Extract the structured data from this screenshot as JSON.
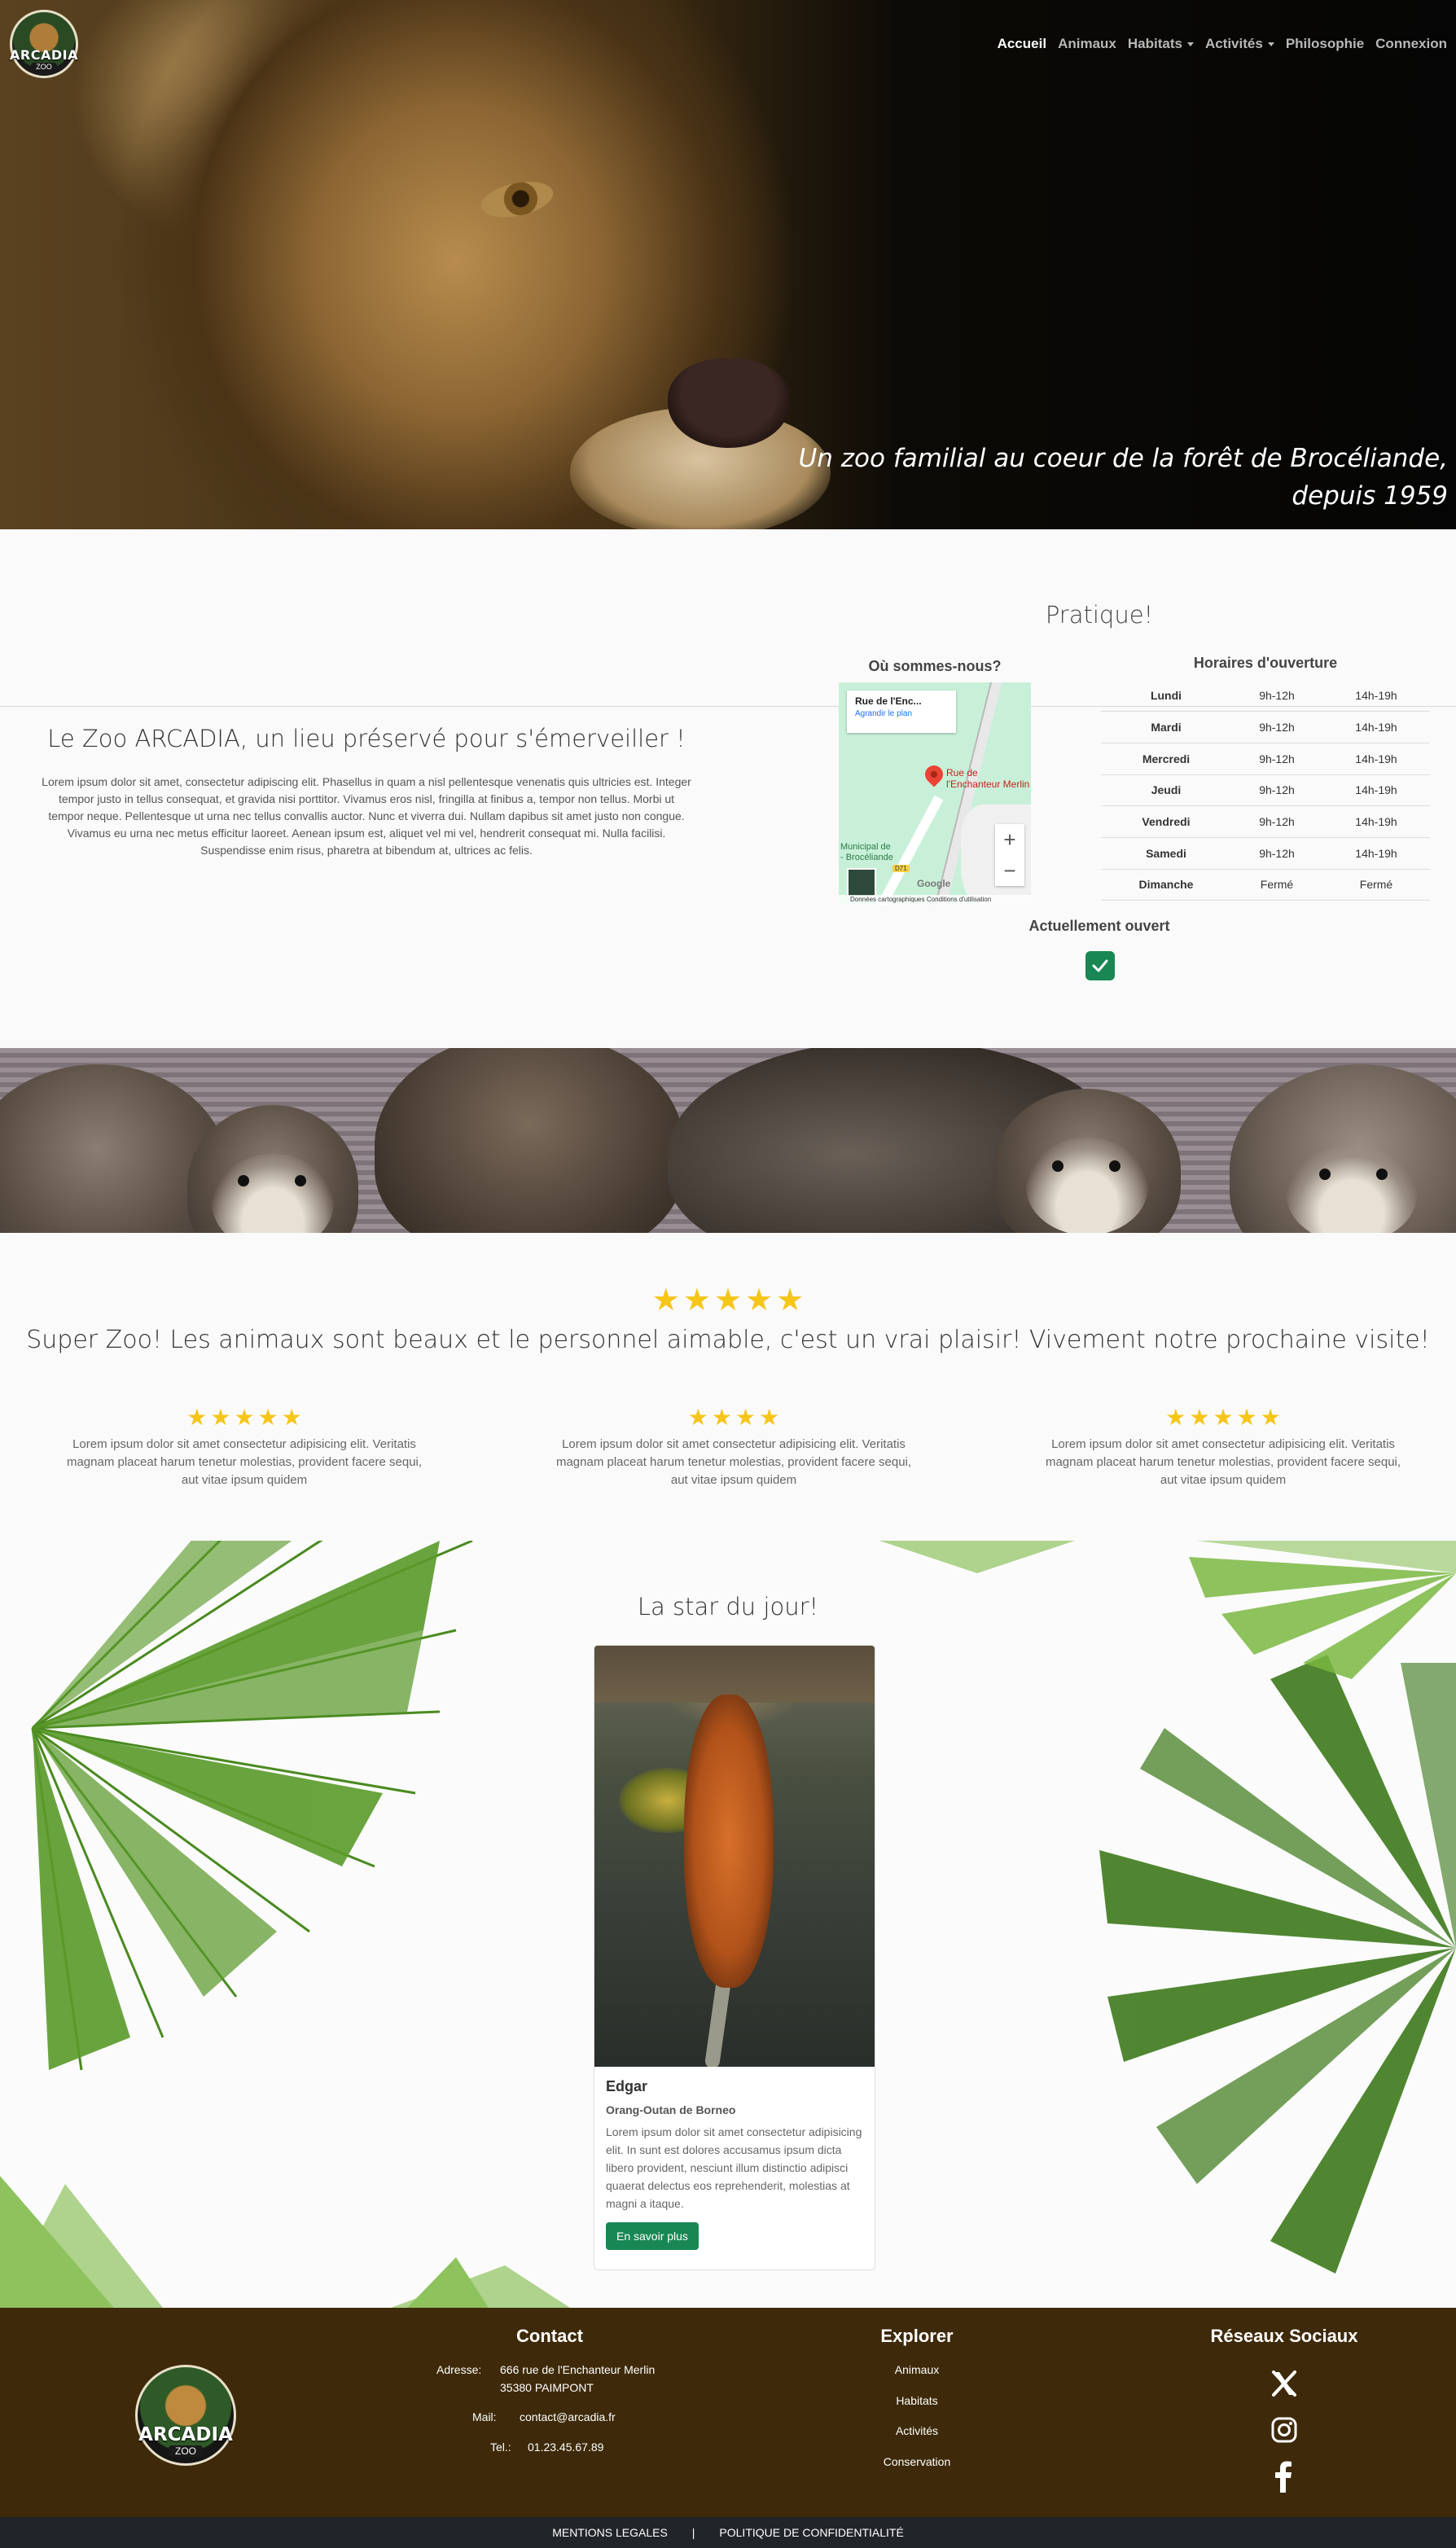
{
  "brand": {
    "logo_text": "ARCADIA",
    "logo_sub": "ZOO"
  },
  "nav": {
    "items": [
      {
        "label": "Accueil",
        "active": true,
        "dropdown": false
      },
      {
        "label": "Animaux",
        "active": false,
        "dropdown": false
      },
      {
        "label": "Habitats",
        "active": false,
        "dropdown": true
      },
      {
        "label": "Activités",
        "active": false,
        "dropdown": true
      },
      {
        "label": "Philosophie",
        "active": false,
        "dropdown": false
      },
      {
        "label": "Connexion",
        "active": false,
        "dropdown": false
      }
    ]
  },
  "hero": {
    "tagline_line1": "Un zoo familial au coeur de la forêt de Brocéliande,",
    "tagline_line2": "depuis 1959"
  },
  "intro": {
    "title": "Le Zoo ARCADIA, un lieu préservé pour s'émerveiller !",
    "text": "Lorem ipsum dolor sit amet, consectetur adipiscing elit. Phasellus in quam a nisl pellentesque venenatis quis ultricies est. Integer tempor justo in tellus consequat, et gravida nisi porttitor. Vivamus eros nisl, fringilla at finibus a, tempor non tellus. Morbi ut tempor neque. Pellentesque ut urna nec tellus convallis auctor. Nunc et viverra dui. Nullam dapibus sit amet justo non congue. Vivamus eu urna nec metus efficitur laoreet. Aenean ipsum est, aliquet vel mi vel, hendrerit consequat mi. Nulla facilisi. Suspendisse enim risus, pharetra at bibendum at, ultrices ac felis."
  },
  "pratique": {
    "title": "Pratique!",
    "map_title": "Où sommes-nous?",
    "map": {
      "card_title": "Rue de l'Enc...",
      "card_link": "Agrandir le plan",
      "pin_label_1": "Rue de",
      "pin_label_2": "l'Enchanteur Merlin",
      "municipality_1": "Municipal de",
      "municipality_2": "- Brocéliande",
      "road_badge": "D71",
      "google": "Google",
      "footer": "Données cartographiques  Conditions d'utilisation",
      "zoom_in": "+",
      "zoom_out": "−"
    },
    "hours_title": "Horaires d'ouverture",
    "hours": [
      {
        "day": "Lundi",
        "morning": "9h-12h",
        "afternoon": "14h-19h"
      },
      {
        "day": "Mardi",
        "morning": "9h-12h",
        "afternoon": "14h-19h"
      },
      {
        "day": "Mercredi",
        "morning": "9h-12h",
        "afternoon": "14h-19h"
      },
      {
        "day": "Jeudi",
        "morning": "9h-12h",
        "afternoon": "14h-19h"
      },
      {
        "day": "Vendredi",
        "morning": "9h-12h",
        "afternoon": "14h-19h"
      },
      {
        "day": "Samedi",
        "morning": "9h-12h",
        "afternoon": "14h-19h"
      },
      {
        "day": "Dimanche",
        "morning": "Fermé",
        "afternoon": "Fermé"
      }
    ],
    "open_status": "Actuellement ouvert",
    "open_checked": true
  },
  "reviews": {
    "featured_stars": 5,
    "featured_quote": "Super Zoo! Les animaux sont beaux et le personnel aimable, c'est un vrai plaisir! Vivement notre prochaine visite!",
    "items": [
      {
        "stars": 5,
        "text": "Lorem ipsum dolor sit amet consectetur adipisicing elit. Veritatis magnam placeat harum tenetur molestias, provident facere sequi, aut vitae ipsum quidem"
      },
      {
        "stars": 4,
        "text": "Lorem ipsum dolor sit amet consectetur adipisicing elit. Veritatis magnam placeat harum tenetur molestias, provident facere sequi, aut vitae ipsum quidem"
      },
      {
        "stars": 5,
        "text": "Lorem ipsum dolor sit amet consectetur adipisicing elit. Veritatis magnam placeat harum tenetur molestias, provident facere sequi, aut vitae ipsum quidem"
      }
    ]
  },
  "star_of_day": {
    "title": "La star du jour!",
    "name": "Edgar",
    "species": "Orang-Outan de Borneo",
    "description": "Lorem ipsum dolor sit amet consectetur adipisicing elit. In sunt est dolores accusamus ipsum dicta libero provident, nesciunt illum distinctio adipisci quaerat delectus eos reprehenderit, molestias at magni a itaque.",
    "button": "En savoir plus"
  },
  "footer": {
    "contact_title": "Contact",
    "address_label": "Adresse:",
    "address_line1": "666 rue de l'Enchanteur Merlin",
    "address_line2": "35380 PAIMPONT",
    "mail_label": "Mail:",
    "mail": "contact@arcadia.fr",
    "tel_label": "Tel.:",
    "tel": "01.23.45.67.89",
    "explore_title": "Explorer",
    "explore_links": [
      "Animaux",
      "Habitats",
      "Activités",
      "Conservation"
    ],
    "social_title": "Réseaux Sociaux",
    "social_icons": [
      "x-icon",
      "instagram-icon",
      "facebook-icon"
    ],
    "legal": "MENTIONS LEGALES",
    "separator": "|",
    "privacy": "POLITIQUE DE CONFIDENTIALITÉ"
  },
  "colors": {
    "footer_bg": "#3e2a0a",
    "button_green": "#198754",
    "star_gold": "#f5c518",
    "bottom_bar": "#212529"
  }
}
